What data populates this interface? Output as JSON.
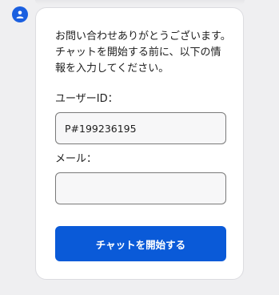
{
  "chat": {
    "intro_text": "お問い合わせありがとうございます。チャットを開始する前に、以下の情報を入力してください。",
    "user_id": {
      "label": "ユーザーID：",
      "value": "P#199236195"
    },
    "email": {
      "label": "メール：",
      "value": ""
    },
    "start_button_label": "チャットを開始する"
  },
  "colors": {
    "accent": "#0a5ad8",
    "avatar_bg": "#1a5fe0",
    "page_bg": "#efeff1",
    "card_bg": "#ffffff",
    "field_border": "#7a7a7a"
  },
  "icons": {
    "avatar": "user-icon"
  }
}
